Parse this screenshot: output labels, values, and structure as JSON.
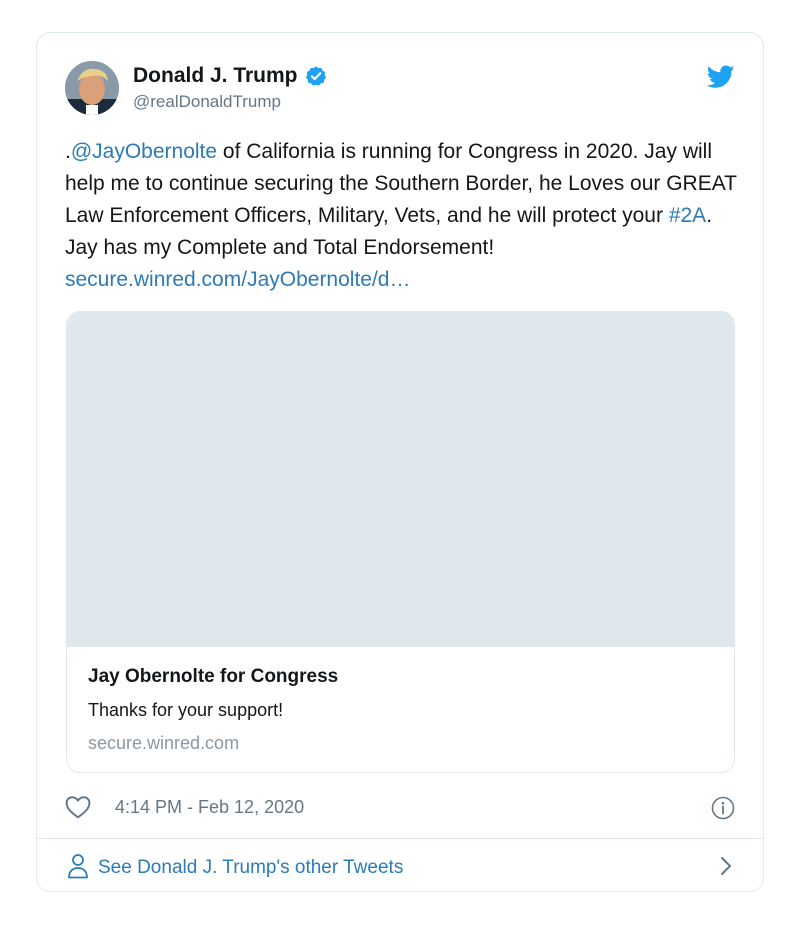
{
  "colors": {
    "link": "#2b7bb9",
    "twitter_blue": "#1da1f2",
    "verified_blue": "#1da1f2",
    "text": "#14171a",
    "secondary": "#657786",
    "border": "#e1e8ed",
    "media_placeholder": "#e1e8ed"
  },
  "author": {
    "display_name": "Donald J. Trump",
    "handle": "@realDonaldTrump",
    "verified_icon": "verified-badge-icon",
    "avatar": "avatar"
  },
  "tweet": {
    "prefix": ".",
    "mention": "@JayObernolte",
    "text_1": " of California is running for Congress in 2020. Jay will help me to continue securing the Southern Border, he Loves our GREAT Law Enforcement Officers, Military, Vets, and he will protect your ",
    "hashtag": "#2A",
    "text_2": ". Jay has my Complete and Total Endorsement! ",
    "url": "secure.winred.com/JayObernolte/d…"
  },
  "link_card": {
    "title": "Jay Obernolte for Congress",
    "description": "Thanks for your support!",
    "domain": "secure.winred.com"
  },
  "meta": {
    "like_icon": "heart-icon",
    "timestamp": "4:14 PM - Feb 12, 2020",
    "info_icon": "info-icon"
  },
  "footer": {
    "icon": "person-icon",
    "label": "See Donald J. Trump's other Tweets",
    "chevron_icon": "chevron-right-icon"
  }
}
